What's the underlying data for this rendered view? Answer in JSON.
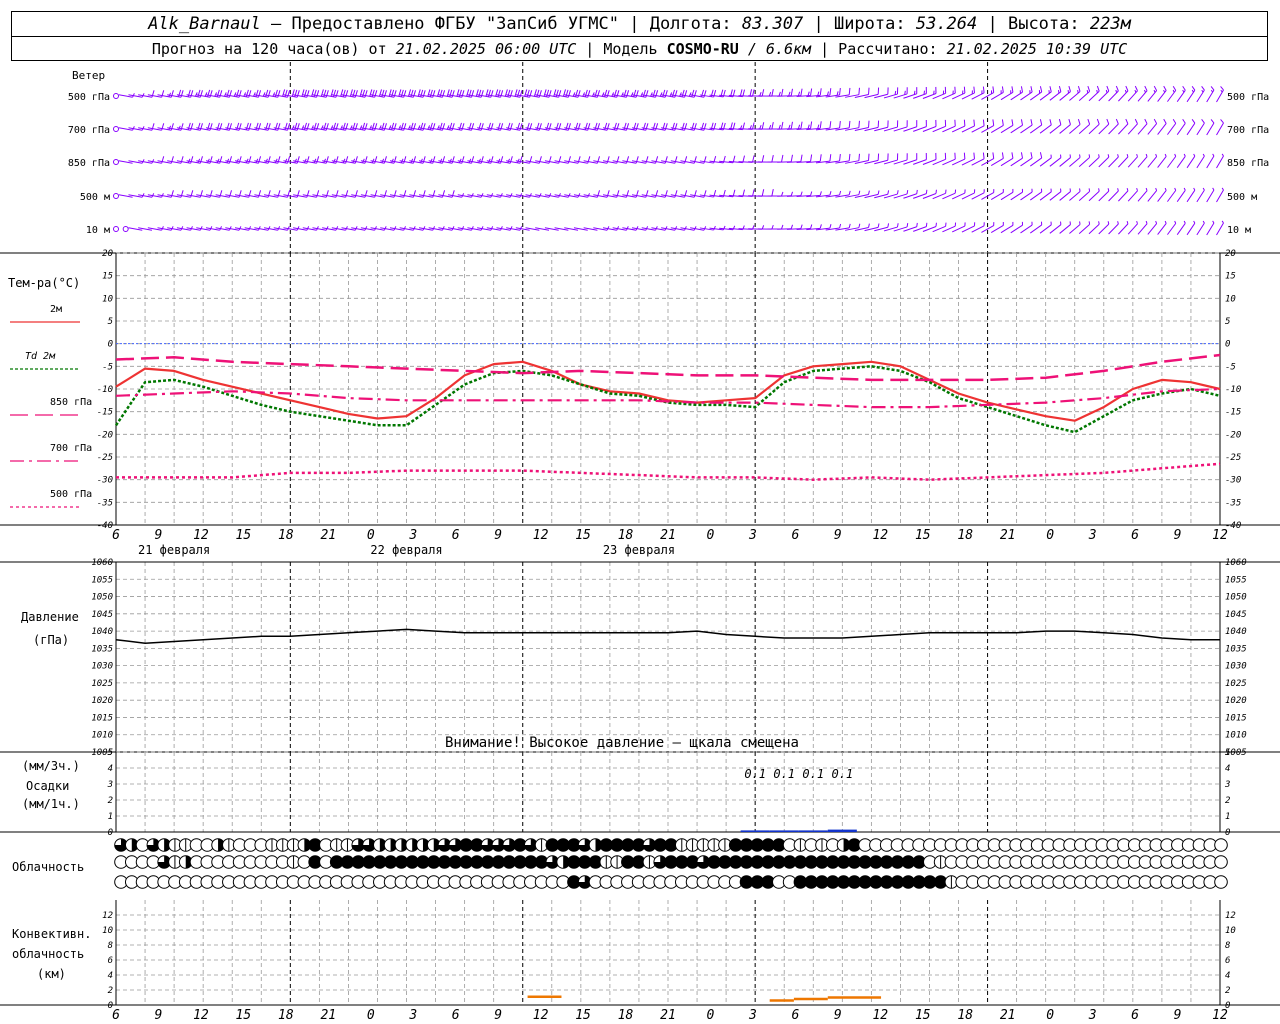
{
  "header": {
    "station": "Alk_Barnaul",
    "provider": " – Предоставлено ФГБУ \"ЗапСиб УГМС\" | Долгота: ",
    "lon": "83.307",
    "lat_label": " | Широта: ",
    "lat": "53.264",
    "alt_label": " | Высота: ",
    "alt": "223м",
    "forecast_prefix": "Прогноз на 120 часа(ов) от ",
    "forecast_start": "21.02.2025 06:00 UTC",
    "model_label": " | Модель ",
    "model": "COSMO-RU",
    "model_res": " / 6.6км",
    "calc_label": " | Рассчитано: ",
    "calc_time": "21.02.2025 10:39 UTC"
  },
  "colors": {
    "wind": "#8800ff",
    "t2m": "#ee3333",
    "td2m": "#007700",
    "t850": "#ee1177",
    "t700": "#ee1177",
    "t500": "#ee1177",
    "pressure": "#000000",
    "precip": "#1133cc",
    "convective": "#ee7700",
    "zero_line": "#4466ff",
    "grid": "#999999"
  },
  "chart_data": [
    {
      "type": "wind-barbs",
      "label": "Ветер",
      "levels": [
        "500 гПа",
        "700 гПа",
        "850 гПа",
        "500 м",
        "10 м"
      ],
      "x_hours": [
        0,
        114
      ],
      "speed_trend": [
        [
          0,
          23,
          27,
          30,
          31,
          30,
          28,
          25,
          22,
          14,
          12,
          13,
          14,
          14,
          14,
          13
        ],
        [
          0,
          20,
          22,
          24,
          23,
          22,
          21,
          20,
          20,
          14,
          11,
          10,
          11,
          10,
          10,
          10
        ],
        [
          0,
          15,
          15,
          14,
          14,
          13,
          12,
          11,
          12,
          9,
          8,
          8,
          8,
          7,
          7,
          7
        ],
        [
          0,
          12,
          12,
          11,
          9,
          6,
          6,
          10,
          11,
          7,
          6,
          6,
          6,
          6,
          6,
          6
        ],
        [
          0,
          5,
          5,
          5,
          4,
          3,
          2,
          3,
          4,
          5,
          4,
          4,
          4,
          3,
          3,
          3
        ]
      ]
    },
    {
      "type": "line",
      "ylabel": "Тем-ра(°C)",
      "ylim": [
        -40,
        20
      ],
      "yticks": [
        20,
        15,
        10,
        5,
        0,
        -5,
        -10,
        -15,
        -20,
        -25,
        -30,
        -35,
        -40
      ],
      "series": [
        {
          "name": "2м",
          "style": "solid",
          "x": [
            0,
            3,
            6,
            9,
            12,
            15,
            18,
            21,
            24,
            27,
            30,
            33,
            36,
            39,
            42,
            45,
            48,
            51,
            54,
            57,
            60,
            63,
            66,
            69,
            72,
            75,
            78,
            81,
            84,
            87,
            90,
            93,
            96,
            99,
            102,
            105,
            108,
            111,
            114
          ],
          "values": [
            -9.5,
            -5.5,
            -6,
            -8,
            -9.5,
            -11,
            -12.5,
            -14,
            -15.5,
            -16.5,
            -16,
            -12,
            -7,
            -4.5,
            -4,
            -6,
            -9,
            -10.5,
            -11,
            -12.5,
            -13,
            -12.5,
            -12,
            -7,
            -5,
            -4.5,
            -4,
            -5,
            -8,
            -11,
            -13,
            -14.5,
            -16,
            -17,
            -14,
            -10,
            -8,
            -8.5,
            -10
          ]
        },
        {
          "name": "Td 2м",
          "style": "dotted",
          "x": [
            0,
            3,
            6,
            9,
            12,
            15,
            18,
            21,
            24,
            27,
            30,
            33,
            36,
            39,
            42,
            45,
            48,
            51,
            54,
            57,
            60,
            63,
            66,
            69,
            72,
            75,
            78,
            81,
            84,
            87,
            90,
            93,
            96,
            99,
            102,
            105,
            108,
            111,
            114
          ],
          "values": [
            -18,
            -8.5,
            -8,
            -9.5,
            -11.5,
            -13.5,
            -15,
            -16,
            -17,
            -18,
            -18,
            -13.5,
            -9,
            -6.5,
            -6,
            -7,
            -9,
            -11,
            -11.5,
            -13,
            -13.5,
            -13.5,
            -14,
            -8.5,
            -6,
            -5.5,
            -5,
            -6,
            -8.5,
            -12,
            -14,
            -16,
            -18,
            -19.5,
            -16,
            -12.5,
            -11,
            -10,
            -11.5
          ]
        },
        {
          "name": "850 гПа",
          "style": "long-dash",
          "x": [
            0,
            6,
            12,
            18,
            24,
            30,
            36,
            42,
            48,
            54,
            60,
            66,
            72,
            78,
            84,
            90,
            96,
            102,
            108,
            114
          ],
          "values": [
            -3.5,
            -3,
            -4,
            -4.5,
            -5,
            -5.5,
            -6,
            -6.5,
            -6,
            -6.5,
            -7,
            -7,
            -7.5,
            -8,
            -8,
            -8,
            -7.5,
            -6,
            -4,
            -2.5
          ]
        },
        {
          "name": "700 гПа",
          "style": "dash-dot",
          "x": [
            0,
            6,
            12,
            18,
            24,
            30,
            36,
            42,
            48,
            54,
            60,
            66,
            72,
            78,
            84,
            90,
            96,
            102,
            108,
            114
          ],
          "values": [
            -11.5,
            -11,
            -10.5,
            -11,
            -12,
            -12.5,
            -12.5,
            -12.5,
            -12.5,
            -12.5,
            -13,
            -13,
            -13.5,
            -14,
            -14,
            -13.5,
            -13,
            -12,
            -10.5,
            -10
          ]
        },
        {
          "name": "500 гПа",
          "style": "short-dot",
          "x": [
            0,
            6,
            12,
            18,
            24,
            30,
            36,
            42,
            48,
            54,
            60,
            66,
            72,
            78,
            84,
            90,
            96,
            102,
            108,
            114
          ],
          "values": [
            -29.5,
            -29.5,
            -29.5,
            -28.5,
            -28.5,
            -28,
            -28,
            -28,
            -28.5,
            -29,
            -29.5,
            -29.5,
            -30,
            -29.5,
            -30,
            -29.5,
            -29,
            -28.5,
            -27.5,
            -26.5
          ]
        }
      ]
    },
    {
      "type": "line",
      "ylabel": "Давление",
      "unit": "(гПа)",
      "ylim": [
        1005,
        1060
      ],
      "yticks": [
        1060,
        1055,
        1050,
        1045,
        1040,
        1035,
        1030,
        1025,
        1020,
        1015,
        1010,
        1005
      ],
      "note": "Внимание! Высокое давление – щкала смещена",
      "series": [
        {
          "name": "",
          "x": [
            0,
            3,
            6,
            9,
            12,
            15,
            18,
            21,
            24,
            27,
            30,
            33,
            36,
            39,
            42,
            45,
            48,
            51,
            54,
            57,
            60,
            63,
            66,
            69,
            72,
            75,
            78,
            81,
            84,
            87,
            90,
            93,
            96,
            99,
            102,
            105,
            108,
            111,
            114
          ],
          "values": [
            1037.5,
            1036.5,
            1037,
            1037.5,
            1038,
            1038.5,
            1038.5,
            1039,
            1039.5,
            1040,
            1040.5,
            1040,
            1039.5,
            1039.5,
            1039.5,
            1039.5,
            1039.5,
            1039.5,
            1039.5,
            1039.5,
            1040,
            1039,
            1038.5,
            1038,
            1038,
            1038,
            1038.5,
            1039,
            1039.5,
            1039.5,
            1039.5,
            1039.5,
            1040,
            1040,
            1039.5,
            1039,
            1038,
            1037.5,
            1037.5
          ]
        }
      ]
    },
    {
      "type": "bar",
      "ylabel_top": "(мм/3ч.)",
      "ylabel": "Осадки",
      "ylabel_bottom": "(мм/1ч.)",
      "ylim": [
        0,
        5
      ],
      "yticks": [
        5,
        4,
        3,
        2,
        1,
        0
      ],
      "labels": [
        {
          "x": 66,
          "text": "0.1"
        },
        {
          "x": 69,
          "text": "0.1"
        },
        {
          "x": 72,
          "text": "0.1"
        },
        {
          "x": 75,
          "text": "0.1"
        }
      ],
      "bars": [
        {
          "x0": 64.5,
          "x1": 67.5,
          "value": 0.1
        },
        {
          "x0": 67.5,
          "x1": 70.5,
          "value": 0.1
        },
        {
          "x0": 70.5,
          "x1": 73.5,
          "value": 0.1
        },
        {
          "x0": 73.5,
          "x1": 76.5,
          "value": 0.15
        }
      ]
    },
    {
      "type": "table",
      "label": "Облачность",
      "rows": [
        [
          3,
          2,
          0,
          3,
          2,
          1,
          1,
          0,
          0,
          2,
          1,
          0,
          0,
          0,
          1,
          1,
          1,
          2,
          4,
          0,
          1,
          1,
          3,
          3,
          2,
          2,
          2,
          2,
          2,
          2,
          3,
          3,
          4,
          4,
          3,
          3,
          3,
          4,
          3,
          1,
          4,
          4,
          4,
          3,
          2,
          4,
          4,
          4,
          4,
          3,
          4,
          4,
          1,
          1,
          1,
          1,
          1,
          4,
          4,
          4,
          4,
          4,
          0,
          1,
          0,
          1,
          0,
          2,
          4,
          0,
          0,
          0,
          0,
          0,
          0,
          0,
          0,
          0,
          0,
          0,
          0,
          0,
          0,
          0,
          0,
          0,
          0,
          0,
          0,
          0,
          0,
          0,
          0,
          0,
          0,
          0,
          0,
          0,
          0,
          0,
          0,
          0,
          0
        ],
        [
          0,
          0,
          0,
          0,
          3,
          1,
          2,
          0,
          0,
          0,
          0,
          0,
          0,
          0,
          0,
          0,
          1,
          0,
          4,
          0,
          4,
          4,
          4,
          4,
          4,
          4,
          4,
          4,
          4,
          4,
          4,
          4,
          4,
          4,
          4,
          4,
          4,
          4,
          4,
          4,
          3,
          2,
          4,
          4,
          4,
          1,
          1,
          4,
          4,
          1,
          3,
          4,
          4,
          4,
          3,
          4,
          4,
          4,
          4,
          4,
          4,
          4,
          4,
          4,
          4,
          4,
          4,
          4,
          4,
          4,
          4,
          4,
          4,
          4,
          4,
          0,
          1,
          0,
          0,
          0,
          0,
          0,
          0,
          0,
          0,
          0,
          0,
          0,
          0,
          0,
          0,
          0,
          0,
          0,
          0,
          0,
          0,
          0,
          0,
          0,
          0,
          0,
          0
        ],
        [
          0,
          0,
          0,
          0,
          0,
          0,
          0,
          0,
          0,
          0,
          0,
          0,
          0,
          0,
          0,
          0,
          0,
          0,
          0,
          0,
          0,
          0,
          0,
          0,
          0,
          0,
          0,
          0,
          0,
          0,
          0,
          0,
          0,
          0,
          0,
          0,
          0,
          0,
          0,
          0,
          0,
          0,
          4,
          3,
          0,
          0,
          0,
          0,
          0,
          0,
          0,
          0,
          0,
          0,
          0,
          0,
          0,
          0,
          4,
          4,
          4,
          0,
          0,
          4,
          4,
          4,
          4,
          4,
          4,
          4,
          4,
          4,
          4,
          4,
          4,
          4,
          4,
          1,
          0,
          0,
          0,
          0,
          0,
          0,
          0,
          0,
          0,
          0,
          0,
          0,
          0,
          0,
          0,
          0,
          0,
          0,
          0,
          0,
          0,
          0,
          0,
          0,
          0
        ]
      ]
    },
    {
      "type": "area",
      "ylabel": "Конвективн.",
      "ylabel2": "облачность",
      "unit": "(км)",
      "ylim": [
        0,
        14
      ],
      "yticks": [
        12,
        10,
        8,
        6,
        4,
        2,
        0
      ],
      "segments": [
        {
          "x0": 42.5,
          "x1": 46,
          "top": 1.1
        },
        {
          "x0": 67.5,
          "x1": 70,
          "top": 0.6
        },
        {
          "x0": 70,
          "x1": 73.5,
          "top": 0.8
        },
        {
          "x0": 73.5,
          "x1": 79,
          "top": 1.0
        }
      ]
    }
  ],
  "axis": {
    "hour_ticks": [
      "6",
      "9",
      "12",
      "15",
      "18",
      "21",
      "0",
      "3",
      "6",
      "9",
      "12",
      "15",
      "18",
      "21",
      "0",
      "3",
      "6",
      "9",
      "12",
      "15",
      "18",
      "21",
      "0",
      "3",
      "6",
      "9",
      "12"
    ],
    "day_labels": [
      "21 февраля",
      "22 февраля",
      "23 февраля"
    ]
  }
}
